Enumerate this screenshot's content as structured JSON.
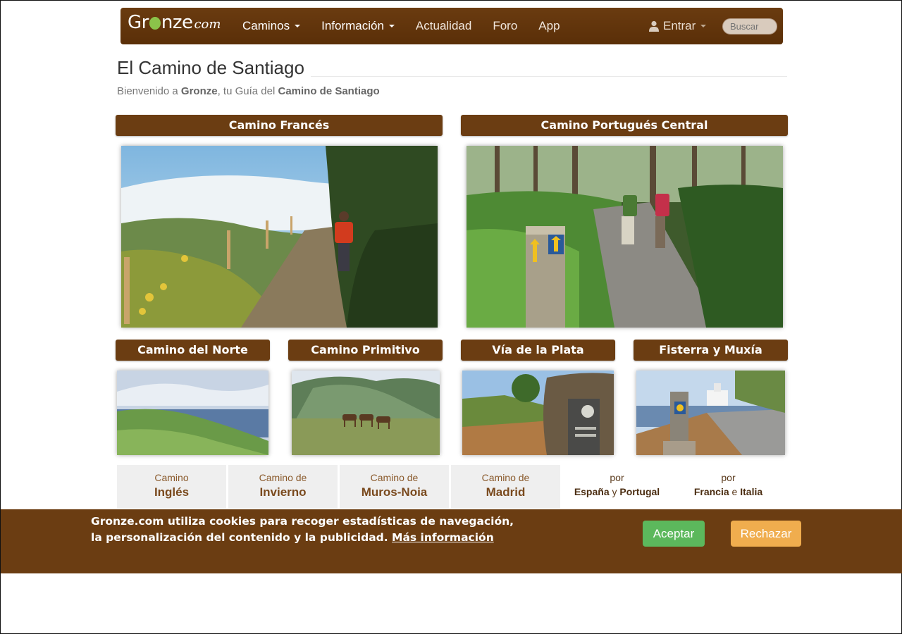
{
  "brand": {
    "logo_pre": "Gr",
    "logo_post": "nze",
    "logo_com": "com"
  },
  "nav": {
    "items": [
      {
        "label": "Caminos",
        "dropdown": true
      },
      {
        "label": "Información",
        "dropdown": true
      },
      {
        "label": "Actualidad",
        "dropdown": false
      },
      {
        "label": "Foro",
        "dropdown": false
      },
      {
        "label": "App",
        "dropdown": false
      }
    ],
    "login_label": "Entrar",
    "search_placeholder": "Buscar"
  },
  "header": {
    "title": "El Camino de Santiago",
    "sub_pre": "Bienvenido a ",
    "sub_brand": "Gronze",
    "sub_mid": ", tu Guía del ",
    "sub_bold": "Camino de Santiago"
  },
  "featured": [
    {
      "title": "Camino Francés",
      "icon": "photo-coastal-trail"
    },
    {
      "title": "Camino Portugués Central",
      "icon": "photo-forest-path"
    }
  ],
  "routes": [
    {
      "title": "Camino del Norte",
      "icon": "photo-coast-hills"
    },
    {
      "title": "Camino Primitivo",
      "icon": "photo-horses-mountain"
    },
    {
      "title": "Vía de la Plata",
      "icon": "photo-stone-marker"
    },
    {
      "title": "Fisterra y Muxía",
      "icon": "photo-lighthouse-road"
    }
  ],
  "more_routes": [
    {
      "small": "Camino",
      "big": "Inglés"
    },
    {
      "small": "Camino de",
      "big": "Invierno"
    },
    {
      "small": "Camino de",
      "big": "Muros-Noia"
    },
    {
      "small": "Camino de",
      "big": "Madrid"
    }
  ],
  "regions": [
    {
      "small": "por",
      "a": "España",
      "conj": "y",
      "b": "Portugal"
    },
    {
      "small": "por",
      "a": "Francia",
      "conj": "e",
      "b": "Italia"
    }
  ],
  "cookie": {
    "line1": "Gronze.com utiliza cookies para recoger estadísticas de navegación,",
    "line2": "la personalización del contenido y la publicidad.",
    "link": "Más información",
    "accept": "Aceptar",
    "reject": "Rechazar"
  },
  "colors": {
    "brown": "#6b3d12",
    "accept": "#5cb85c",
    "reject": "#f0ad4e"
  }
}
